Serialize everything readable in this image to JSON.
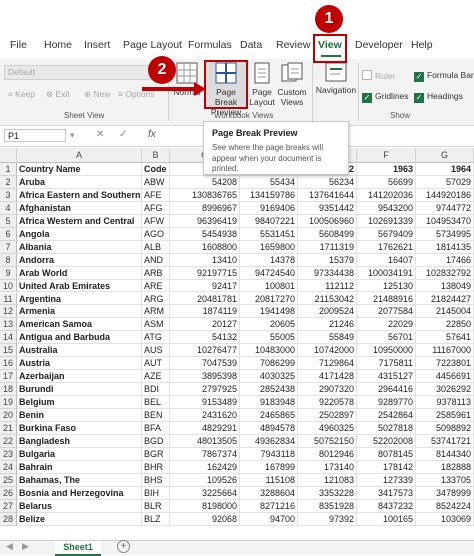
{
  "menu": [
    "File",
    "Home",
    "Insert",
    "Page Layout",
    "Formulas",
    "Data",
    "Review",
    "View",
    "Developer",
    "Help"
  ],
  "ribbon": {
    "style_dropdown": "Default",
    "sheet_view_buttons": [
      "Keep",
      "Exit",
      "New",
      "Options"
    ],
    "sheet_view_label": "Sheet View",
    "workbook_views": [
      "Normal",
      "Page Break Preview",
      "Page Layout",
      "Custom Views"
    ],
    "workbook_views_label": "Workbook Views",
    "navigation": "Navigation",
    "show": {
      "ruler": "Ruler",
      "gridlines": "Gridlines",
      "formula_bar": "Formula Bar",
      "headings": "Headings"
    },
    "show_label": "Show"
  },
  "tooltip": {
    "title": "Page Break Preview",
    "description": "See where the page breaks will appear when your document is printed."
  },
  "formula_bar": {
    "name_box": "P1",
    "fx": "fx"
  },
  "callouts": [
    "1",
    "2"
  ],
  "columns": [
    "A",
    "B",
    "C",
    "D",
    "E",
    "F",
    "G"
  ],
  "header_row": [
    "Country Name",
    "Code",
    "1960",
    "1961",
    "1962",
    "1963",
    "1964"
  ],
  "rows": [
    [
      "Aruba",
      "ABW",
      "54208",
      "55434",
      "56234",
      "56699",
      "57029"
    ],
    [
      "Africa Eastern and Southern",
      "AFE",
      "130836765",
      "134159786",
      "137641644",
      "141202036",
      "144920186"
    ],
    [
      "Afghanistan",
      "AFG",
      "8996967",
      "9169406",
      "9351442",
      "9543200",
      "9744772"
    ],
    [
      "Africa Western and Central",
      "AFW",
      "96396419",
      "98407221",
      "100506960",
      "102691339",
      "104953470"
    ],
    [
      "Angola",
      "AGO",
      "5454938",
      "5531451",
      "5608499",
      "5679409",
      "5734995"
    ],
    [
      "Albania",
      "ALB",
      "1608800",
      "1659800",
      "1711319",
      "1762621",
      "1814135"
    ],
    [
      "Andorra",
      "AND",
      "13410",
      "14378",
      "15379",
      "16407",
      "17466"
    ],
    [
      "Arab World",
      "ARB",
      "92197715",
      "94724540",
      "97334438",
      "100034191",
      "102832792"
    ],
    [
      "United Arab Emirates",
      "ARE",
      "92417",
      "100801",
      "112112",
      "125130",
      "138049"
    ],
    [
      "Argentina",
      "ARG",
      "20481781",
      "20817270",
      "21153042",
      "21488916",
      "21824427"
    ],
    [
      "Armenia",
      "ARM",
      "1874119",
      "1941498",
      "2009524",
      "2077584",
      "2145004"
    ],
    [
      "American Samoa",
      "ASM",
      "20127",
      "20605",
      "21246",
      "22029",
      "22850"
    ],
    [
      "Antigua and Barbuda",
      "ATG",
      "54132",
      "55005",
      "55849",
      "56701",
      "57641"
    ],
    [
      "Australia",
      "AUS",
      "10276477",
      "10483000",
      "10742000",
      "10950000",
      "11167000"
    ],
    [
      "Austria",
      "AUT",
      "7047539",
      "7086299",
      "7129864",
      "7175811",
      "7223801"
    ],
    [
      "Azerbaijan",
      "AZE",
      "3895398",
      "4030325",
      "4171428",
      "4315127",
      "4456691"
    ],
    [
      "Burundi",
      "BDI",
      "2797925",
      "2852438",
      "2907320",
      "2964416",
      "3026292"
    ],
    [
      "Belgium",
      "BEL",
      "9153489",
      "9183948",
      "9220578",
      "9289770",
      "9378113"
    ],
    [
      "Benin",
      "BEN",
      "2431620",
      "2465865",
      "2502897",
      "2542864",
      "2585961"
    ],
    [
      "Burkina Faso",
      "BFA",
      "4829291",
      "4894578",
      "4960325",
      "5027818",
      "5098892"
    ],
    [
      "Bangladesh",
      "BGD",
      "48013505",
      "49362834",
      "50752150",
      "52202008",
      "53741721"
    ],
    [
      "Bulgaria",
      "BGR",
      "7867374",
      "7943118",
      "8012946",
      "8078145",
      "8144340"
    ],
    [
      "Bahrain",
      "BHR",
      "162429",
      "167899",
      "173140",
      "178142",
      "182888"
    ],
    [
      "Bahamas, The",
      "BHS",
      "109526",
      "115108",
      "121083",
      "127339",
      "133705"
    ],
    [
      "Bosnia and Herzegovina",
      "BIH",
      "3225664",
      "3288604",
      "3353228",
      "3417573",
      "3478999"
    ],
    [
      "Belarus",
      "BLR",
      "8198000",
      "8271216",
      "8351928",
      "8437232",
      "8524224"
    ],
    [
      "Belize",
      "BLZ",
      "92068",
      "94700",
      "97392",
      "100165",
      "103069"
    ]
  ],
  "sheet_tab": "Sheet1"
}
